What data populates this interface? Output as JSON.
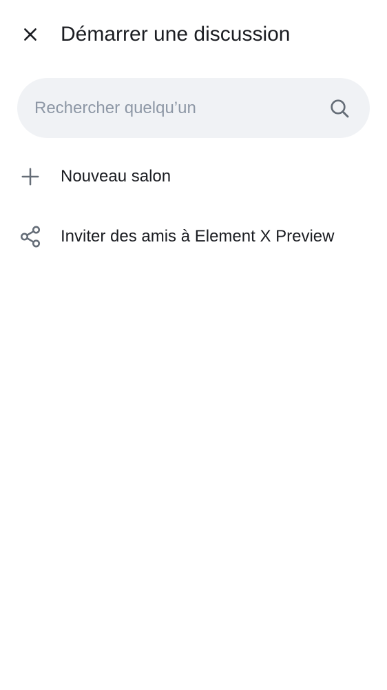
{
  "header": {
    "title": "Démarrer une discussion",
    "close_icon": "close-icon"
  },
  "search": {
    "placeholder": "Rechercher quelqu’un",
    "value": "",
    "icon": "search-icon"
  },
  "actions": [
    {
      "label": "Nouveau salon",
      "icon": "plus-icon"
    },
    {
      "label": "Inviter des amis à Element X Preview",
      "icon": "share-icon"
    }
  ],
  "colors": {
    "text": "#1b1d22",
    "icon": "#656d77",
    "search_background": "#f0f2f5",
    "placeholder": "#8d97a5"
  }
}
